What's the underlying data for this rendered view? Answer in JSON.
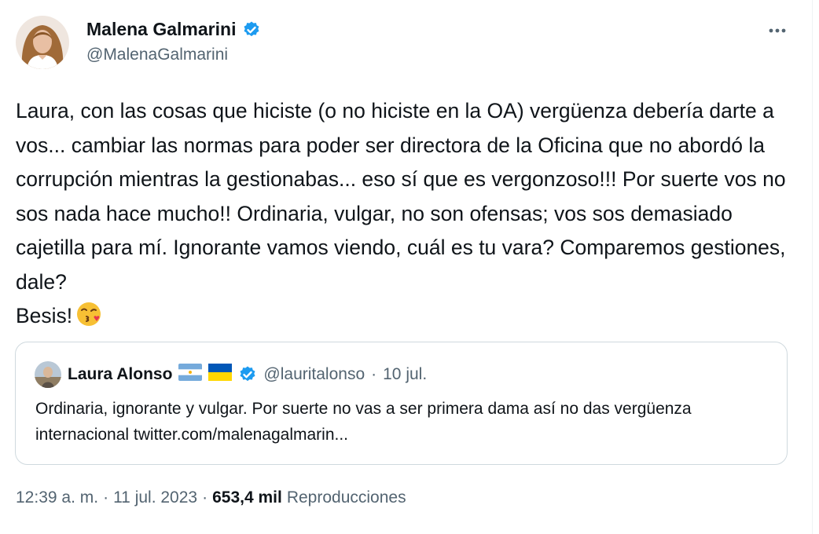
{
  "author": {
    "name": "Malena Galmarini",
    "handle": "@MalenaGalmarini",
    "verified": true
  },
  "tweet": {
    "lines": [
      "Laura, con las cosas que hiciste (o no hiciste en la OA) vergüenza debería darte a vos... cambiar las normas para poder ser directora de la Oficina que no abordó la corrupción mientras la gestionabas... eso sí que es vergonzoso!!! Por suerte vos no sos nada hace mucho!! Ordinaria, vulgar, no son ofensas; vos sos demasiado cajetilla para mí. Ignorante vamos viendo, cuál es tu vara? Comparemos gestiones, dale?",
      "Besis!"
    ],
    "emoji": "kissing-face-emoji"
  },
  "quote": {
    "name": "Laura Alonso",
    "flags": [
      "argentina-flag",
      "ukraine-flag"
    ],
    "handle": "@lauritalonso",
    "separator": "·",
    "date": "10 jul.",
    "text": "Ordinaria, ignorante y vulgar. Por suerte no vas a ser primera dama así no das vergüenza internacional twitter.com/malenagalmarin..."
  },
  "meta": {
    "time": "12:39 a. m.",
    "sep1": "·",
    "date": "11 jul. 2023",
    "sep2": "·",
    "views": "653,4 mil",
    "views_label": "Reproducciones"
  },
  "colors": {
    "verified": "#1d9bf0",
    "secondary_text": "#536471",
    "border": "#cfd9de"
  }
}
